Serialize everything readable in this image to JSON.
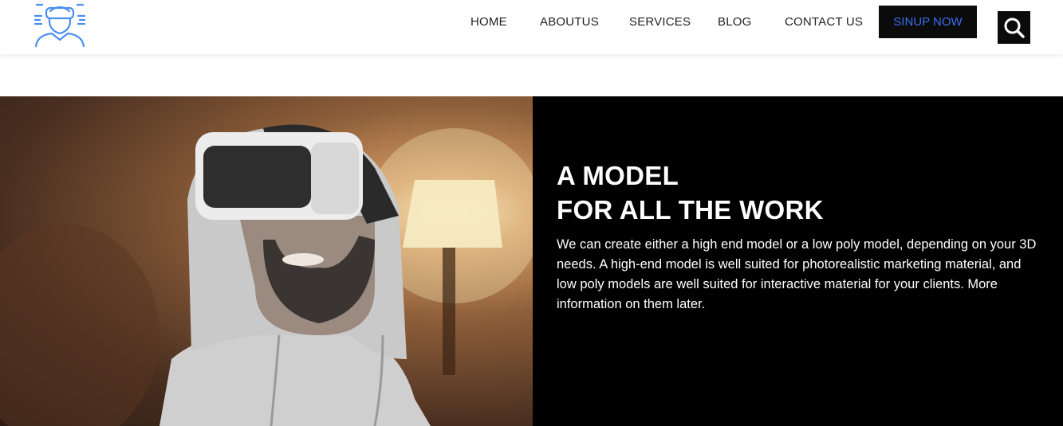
{
  "header": {
    "logo_icon": "vr-person-icon",
    "nav": [
      "HOME",
      "ABOUTUS",
      "SERVICES",
      "BLOG",
      "CONTACT US"
    ],
    "signup_label": "SINUP NOW",
    "search_icon": "search-icon"
  },
  "hero": {
    "image": "man-wearing-vr-headset-photo",
    "title_line1": "A MODEL",
    "title_line2": "FOR ALL THE WORK",
    "text": "We can create either a high end model or a low poly model, depending on your 3D needs. A high-end model is well suited for photorealistic marketing material, and low poly models are well suited for interactive material for your clients. More information on them later."
  },
  "colors": {
    "accent": "#3a6ff0",
    "dark": "#0b0b0b",
    "logo": "#4a8ef0"
  }
}
